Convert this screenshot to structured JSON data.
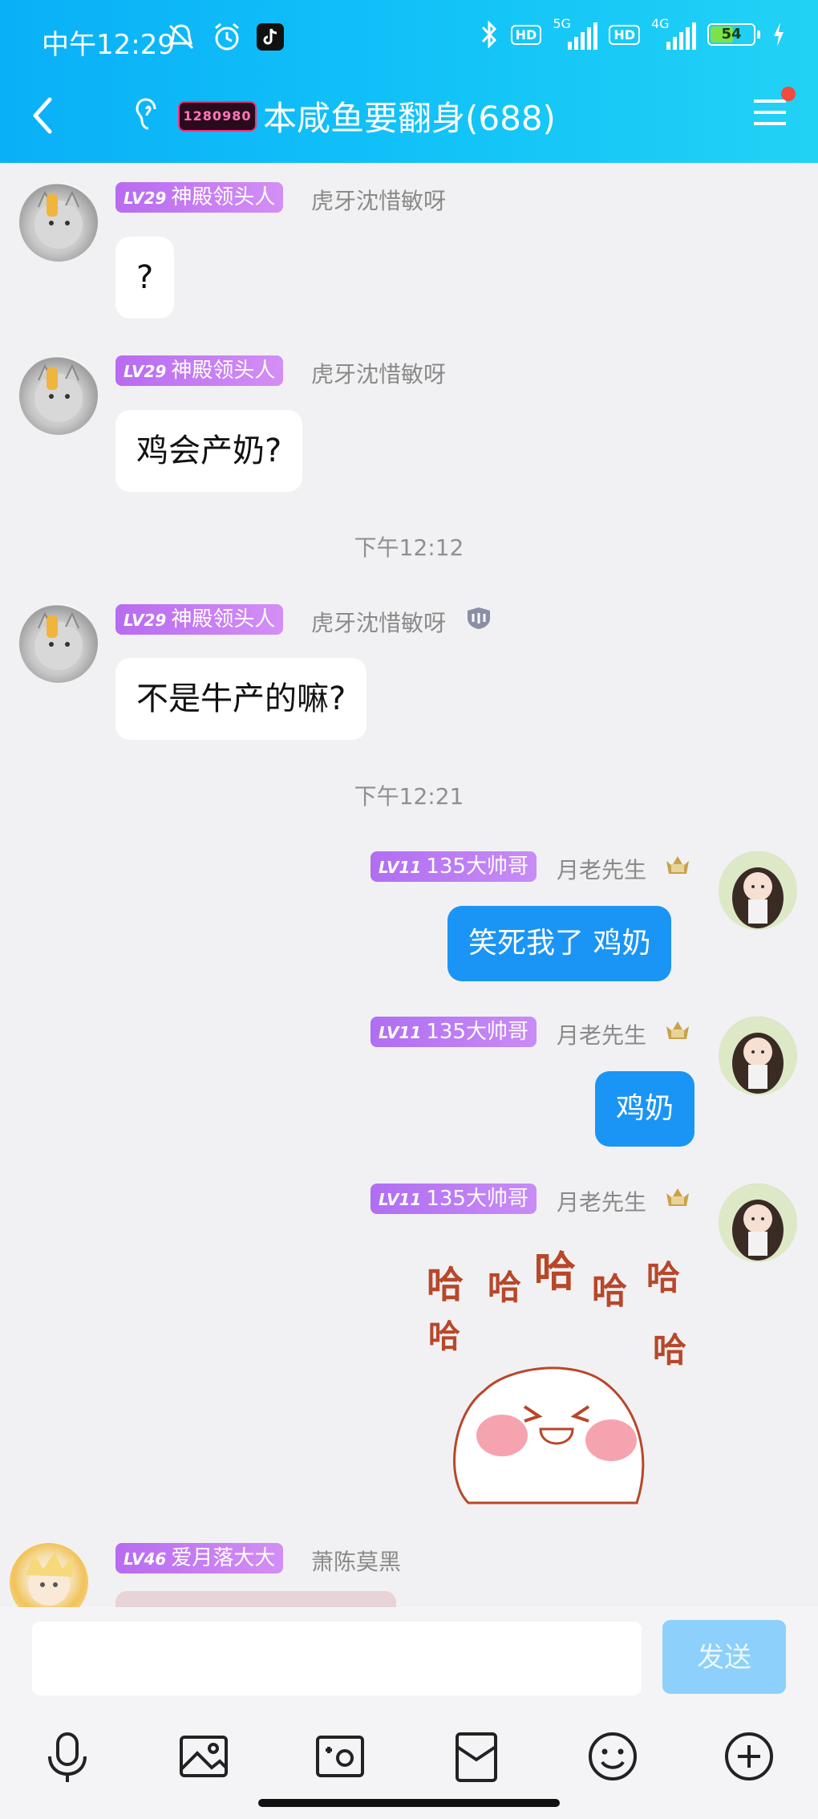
{
  "status_bar": {
    "time": "中午12:29",
    "hd1": "HD",
    "net1": "5G",
    "hd2": "HD",
    "net2": "4G",
    "battery": "54",
    "battery_level": 0.54
  },
  "header": {
    "title": "本咸鱼要翻身(688)",
    "group_badge": "1280980"
  },
  "messages": [
    {
      "level": "LV29",
      "tag": "神殿领头人",
      "nickname": "虎牙沈惜敏呀",
      "text": "?"
    },
    {
      "level": "LV29",
      "tag": "神殿领头人",
      "nickname": "虎牙沈惜敏呀",
      "text": "鸡会产奶?"
    },
    {
      "level": "LV29",
      "tag": "神殿领头人",
      "nickname": "虎牙沈惜敏呀",
      "text": "不是牛产的嘛?"
    },
    {
      "level": "LV11",
      "tag": "135大帅哥",
      "nickname": "月老先生",
      "text": "笑死我了 鸡奶"
    },
    {
      "level": "LV11",
      "tag": "135大帅哥",
      "nickname": "月老先生",
      "text": "鸡奶"
    },
    {
      "level": "LV11",
      "tag": "135大帅哥",
      "nickname": "月老先生",
      "sticker_text": [
        "哈",
        "哈",
        "哈",
        "哈",
        "哈",
        "哈",
        "哈"
      ]
    },
    {
      "level": "LV46",
      "tag": "爱月落大大",
      "nickname": "萧陈莫黑"
    }
  ],
  "timestamps": [
    "下午12:12",
    "下午12:21"
  ],
  "input": {
    "placeholder": "",
    "send_label": "发送"
  },
  "colors": {
    "header_start": "#0ab0f7",
    "header_end": "#22d2f5",
    "my_bubble": "#1a95f5",
    "send_disabled": "#8cd0fb",
    "level_tag": "#c17ef3"
  },
  "toolbar_icons": [
    "microphone-icon",
    "image-icon",
    "camera-icon",
    "red-packet-icon",
    "emoji-icon",
    "plus-icon"
  ]
}
